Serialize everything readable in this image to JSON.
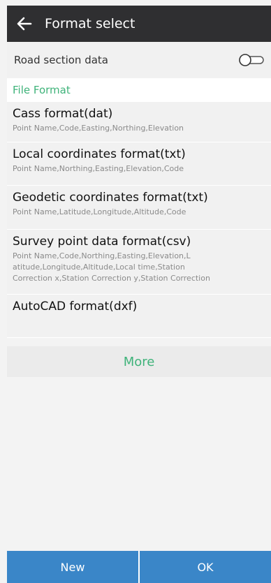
{
  "header": {
    "title": "Format select",
    "back_icon": "arrow-left-icon"
  },
  "road_section": {
    "label": "Road section data",
    "toggle_on": false
  },
  "file_format": {
    "section_label": "File Format",
    "items": [
      {
        "title": "Cass format(dat)",
        "desc": "Point Name,Code,Easting,Northing,Elevation"
      },
      {
        "title": "Local coordinates format(txt)",
        "desc": "Point Name,Northing,Easting,Elevation,Code"
      },
      {
        "title": "Geodetic coordinates format(txt)",
        "desc": "Point Name,Latitude,Longitude,Altitude,Code"
      },
      {
        "title": "Survey point data format(csv)",
        "desc_lines": [
          "Point Name,Code,Northing,Easting,Elevation,L",
          "atitude,Longitude,Altitude,Local time,Station",
          "Correction x,Station Correction y,Station Correction"
        ]
      },
      {
        "title": "AutoCAD format(dxf)",
        "desc": ""
      }
    ],
    "more_label": "More"
  },
  "footer": {
    "new_label": "New",
    "ok_label": "OK"
  },
  "colors": {
    "header_bg": "#2f2f31",
    "accent_green": "#3fb37a",
    "button_blue": "#3a86c8"
  }
}
